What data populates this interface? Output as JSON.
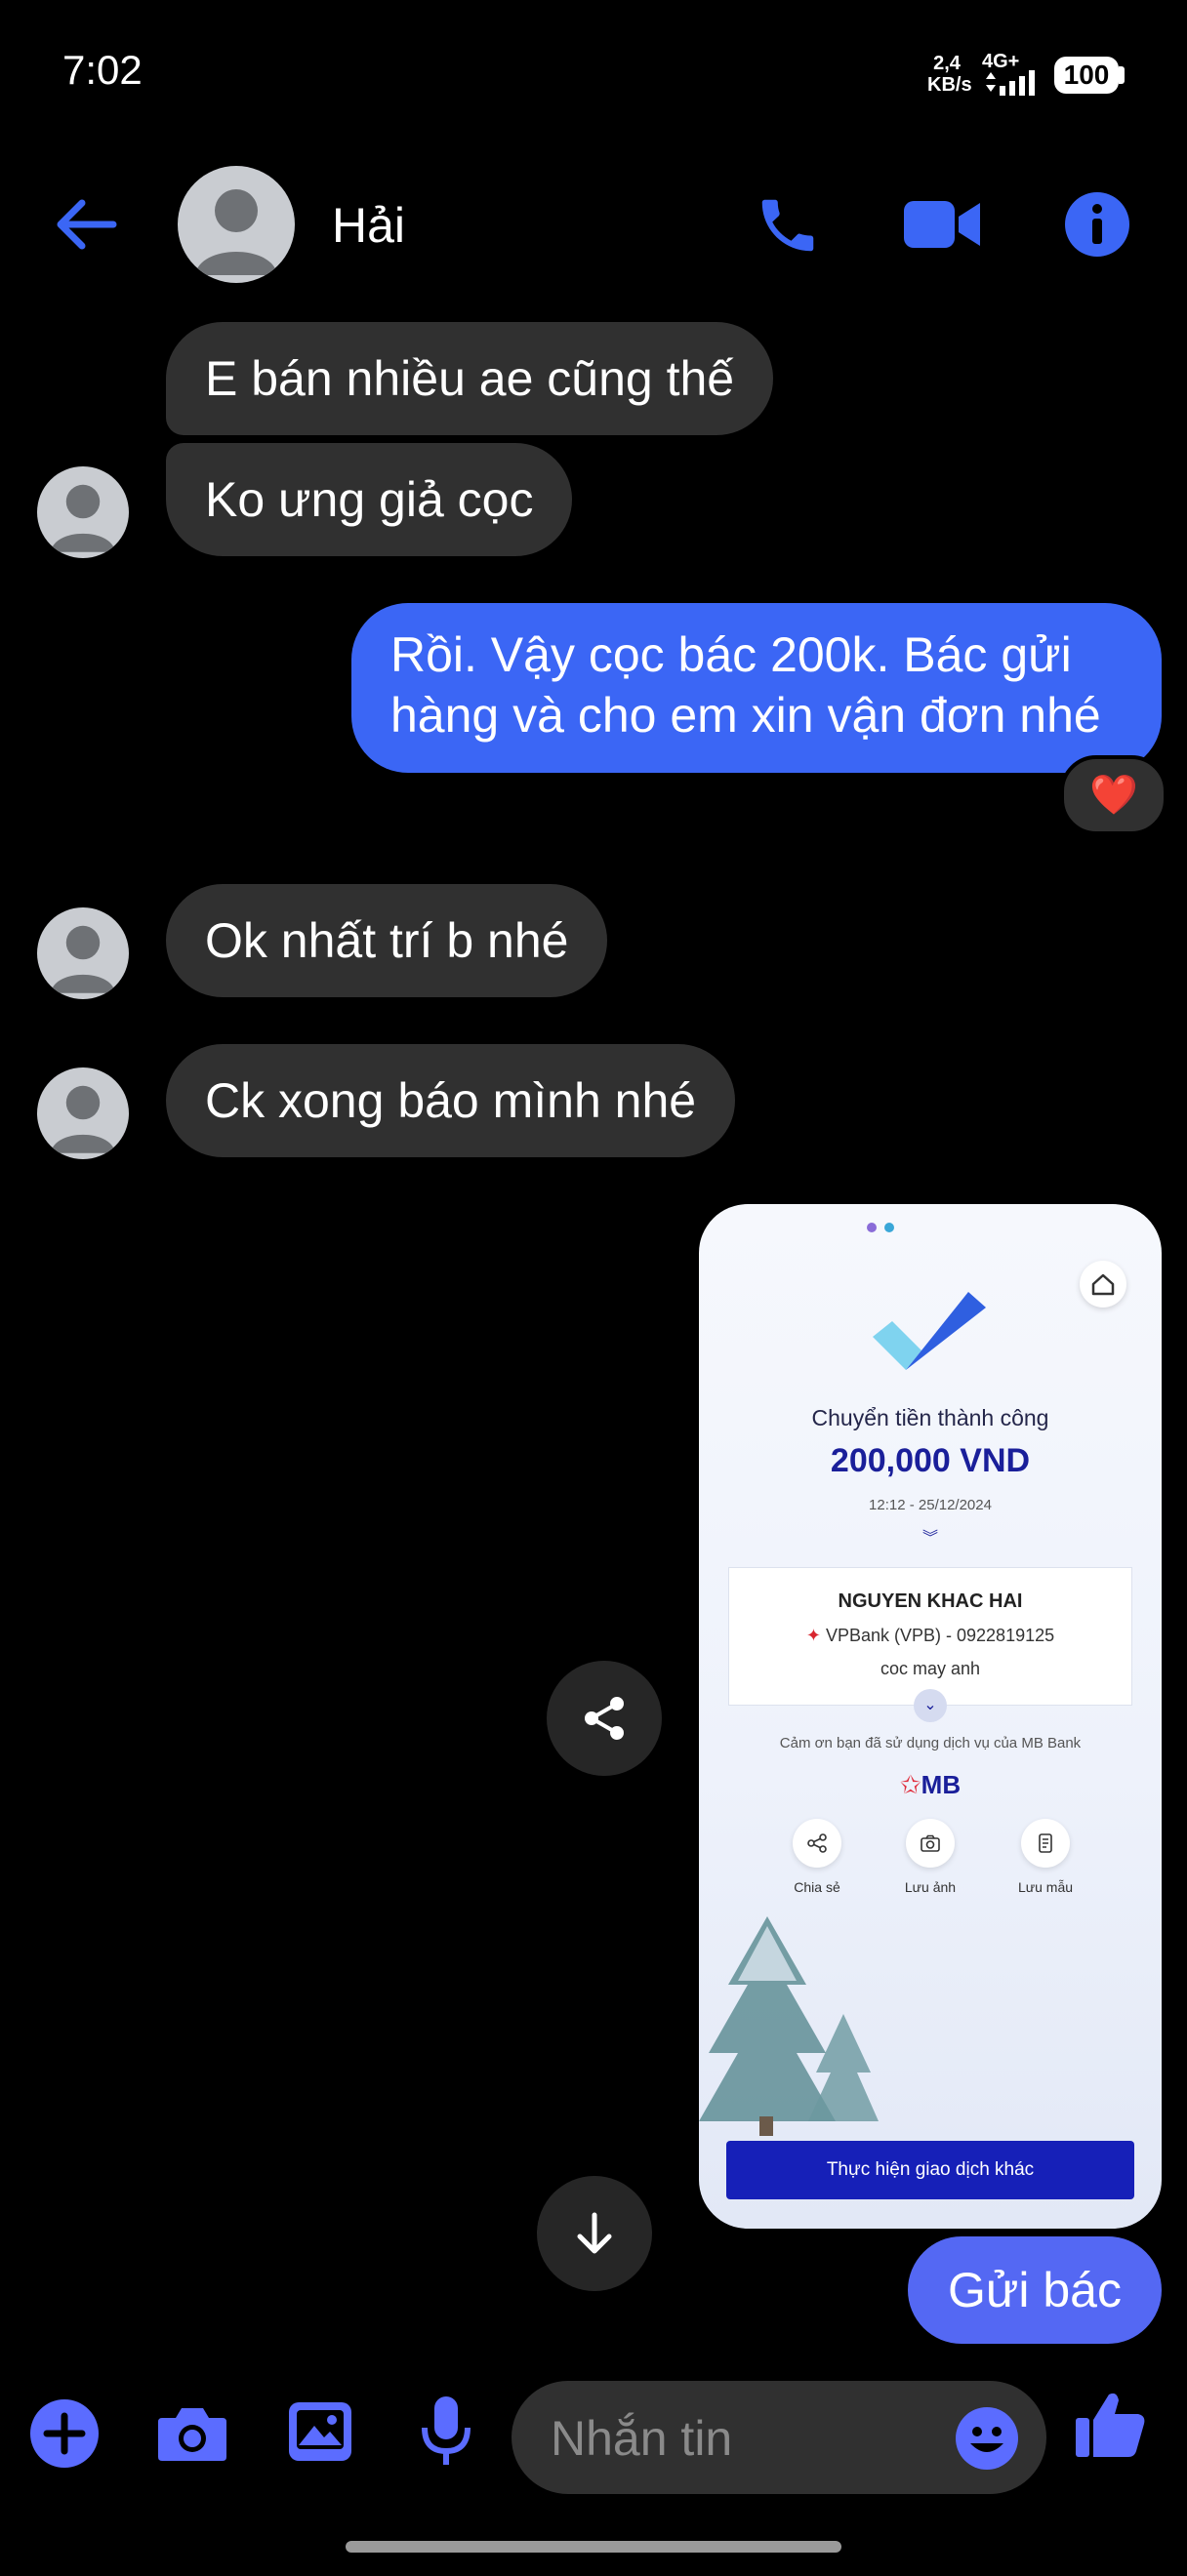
{
  "status_bar": {
    "time": "7:02",
    "net_speed_value": "2,4",
    "net_speed_unit": "KB/s",
    "network": "4G+",
    "battery": "100"
  },
  "header": {
    "contact_name": "Hải",
    "icons": [
      "back-arrow-icon",
      "avatar",
      "phone-icon",
      "video-camera-icon",
      "info-icon"
    ]
  },
  "messages": {
    "m1": "E bán nhiều ae cũng thế",
    "m2": "Ko ưng giả cọc",
    "m3_line1": "Rồi. Vậy cọc bác 200k. Bác gửi",
    "m3_line2": "hàng và cho em xin vận đơn nhé",
    "m3_reaction": "❤️",
    "m4": "Ok nhất trí b nhé",
    "m5": "Ck xong báo mình nhé",
    "m6": "Gửi bác"
  },
  "shared_image": {
    "title": "Chuyển tiền thành công",
    "amount": "200,000 VND",
    "datetime": "12:12 - 25/12/2024",
    "recipient": "NGUYEN KHAC HAI",
    "bank": "VPBank (VPB) - 0922819125",
    "note": "coc may anh",
    "thanks": "Cảm ơn bạn đã sử dụng dịch vụ của MB Bank",
    "brand": "MB",
    "actions": [
      "Chia sẻ",
      "Lưu ảnh",
      "Lưu mẫu"
    ],
    "button": "Thực hiện giao dịch khác"
  },
  "composer": {
    "placeholder": "Nhắn tin"
  },
  "colors": {
    "accent": "#3b66f5",
    "icon_blue": "#5b6cff",
    "incoming_bubble": "#303030",
    "background": "#000000"
  }
}
